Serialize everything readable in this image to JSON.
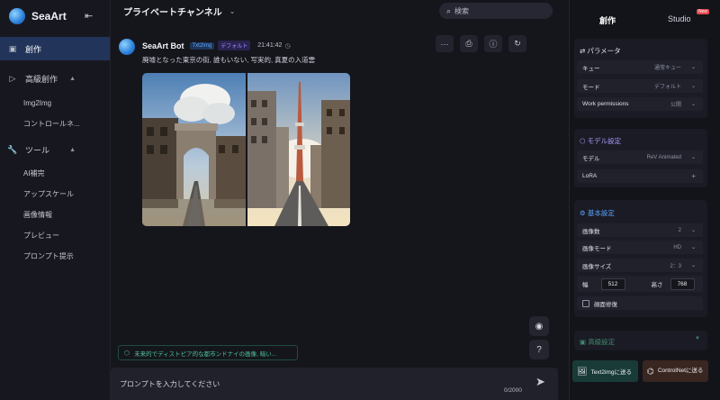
{
  "sidebar": {
    "brand": "SeaArt",
    "items": [
      {
        "label": "創作",
        "icon": "canvas-icon"
      },
      {
        "label": "高級創作",
        "icon": "play-icon"
      },
      {
        "label": "ツール",
        "icon": "wrench-icon"
      }
    ],
    "advanced_sub": [
      "Img2Img",
      "コントロールネ..."
    ],
    "tools_sub": [
      "AI補完",
      "アップスケール",
      "画像情報",
      "プレビュー",
      "プロンプト提示"
    ]
  },
  "header": {
    "channel": "プライベートチャンネル",
    "search_placeholder": "検索"
  },
  "message": {
    "bot_name": "SeaArt Bot",
    "tag_mode": "Txt2Img",
    "tag_default": "デフォルト",
    "time": "21:41:42",
    "prompt": "廃墟となった東京の街, 誰もいない, 写実的, 真夏の入道雲"
  },
  "composer": {
    "suggestion": "未来的でディストピア的な都市ンドナイの画像, 暗い...",
    "placeholder": "プロンプトを入力してください",
    "counter": "0/2000",
    "help": "?"
  },
  "right_panel": {
    "tab_create": "創作",
    "tab_studio": "Studio",
    "new_badge": "New",
    "params": {
      "title": "パラメータ",
      "rows": [
        {
          "label": "キュー",
          "value": "通常キュー"
        },
        {
          "label": "モード",
          "value": "デフォルト"
        },
        {
          "label": "Work permissions",
          "value": "公開"
        }
      ]
    },
    "model": {
      "title": "モデル設定",
      "model_label": "モデル",
      "model_value": "ReV Animated",
      "lora_label": "LoRA"
    },
    "basic": {
      "title": "基本設定",
      "count_label": "画像数",
      "count_value": "2",
      "mode_label": "画像モード",
      "mode_value": "HD",
      "size_label": "画像サイズ",
      "size_value": "2：3",
      "width_label": "幅",
      "width_value": "512",
      "height_label": "高さ",
      "height_value": "768",
      "face_fix_label": "顔面修復"
    },
    "advanced_title": "高級設定",
    "btn_txt2img": "Text2imgに送る",
    "btn_controlnet": "ControlNetに送る"
  },
  "colors": {
    "accent": "#2b7fd9",
    "active_nav": "#22345a",
    "suggest_green": "#4fc39a",
    "new_badge": "#e5484d"
  }
}
